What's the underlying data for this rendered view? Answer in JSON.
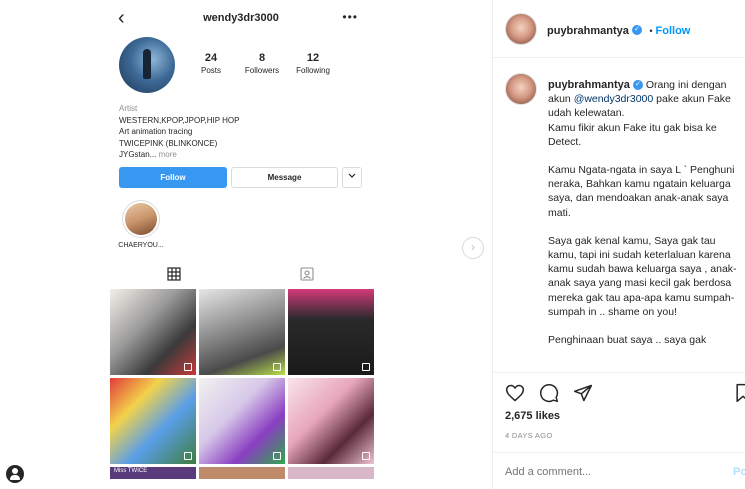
{
  "profile": {
    "username": "wendy3dr3000",
    "stats": [
      {
        "num": "24",
        "label": "Posts"
      },
      {
        "num": "8",
        "label": "Followers"
      },
      {
        "num": "12",
        "label": "Following"
      }
    ],
    "bio_category": "Artist",
    "bio_lines": [
      "WESTERN,KPOP,JPOP,HIP HOP",
      "Art animation tracing",
      "TWICEPINK (BLINKONCE)"
    ],
    "bio_last": "JYGstan...",
    "bio_more": "more",
    "follow_label": "Follow",
    "message_label": "Message",
    "highlight_label": "CHAERYOU...",
    "grid_badge_text": "Miss TWICE"
  },
  "post": {
    "username": "puybrahmantya",
    "separator": "•",
    "follow_label": "Follow",
    "caption_prefix": "Orang ini dengan akun ",
    "mention": "@wendy3dr3000",
    "caption_suffix": " pake akun Fake udah kelewatan.",
    "caption_line2": "Kamu fikir akun Fake itu gak bisa ke Detect.",
    "paragraphs": [
      "Kamu Ngata-ngata in saya L  ` Penghuni neraka, Bahkan kamu ngatain keluarga saya, dan mendoakan anak-anak saya mati.",
      "Saya gak kenal kamu, Saya gak tau kamu, tapi ini sudah keterlaluan karena kamu sudah bawa keluarga saya , anak-anak saya yang masi kecil gak berdosa mereka gak tau apa-apa kamu sumpah-sumpah in .. shame on you!",
      "Penghinaan buat saya .. saya gak"
    ],
    "likes": "2,675 likes",
    "time_ago": "4 DAYS AGO",
    "comment_placeholder": "Add a comment...",
    "post_label": "Po"
  },
  "colors": {
    "accent": "#0095f6",
    "follow_button": "#3897f0",
    "muted": "#8e8e8e"
  }
}
